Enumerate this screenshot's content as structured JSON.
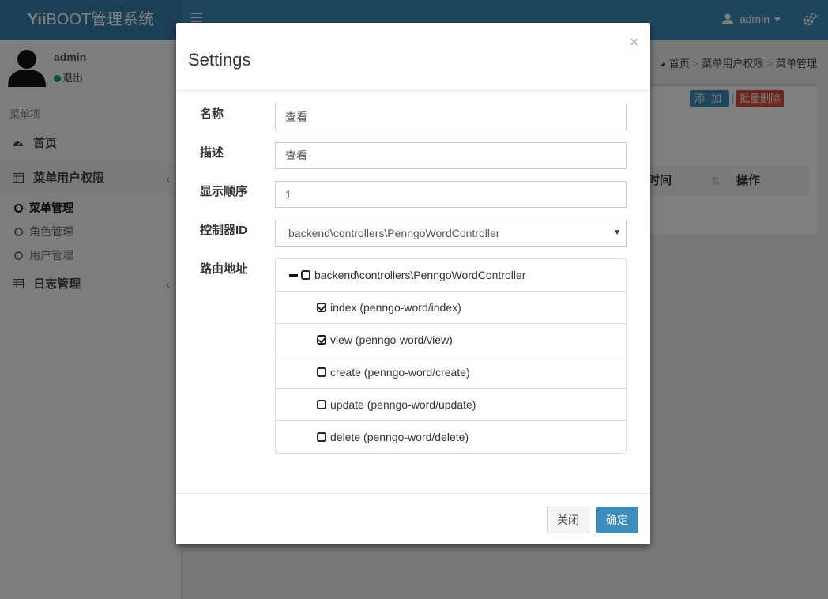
{
  "app": {
    "logo_bold": "Yii",
    "logo_rest": "BOOT管理系统",
    "user_menu": "admin"
  },
  "sidebar": {
    "user_name": "admin",
    "status": "退出",
    "menu_header": "菜单项",
    "items": [
      {
        "label": "首页"
      },
      {
        "label": "菜单用户权限"
      },
      {
        "label": "日志管理"
      }
    ],
    "subitems": [
      {
        "label": "菜单管理"
      },
      {
        "label": "角色管理"
      },
      {
        "label": "用户管理"
      }
    ]
  },
  "breadcrumb": [
    "首页",
    "菜单用户权限",
    "菜单管理"
  ],
  "content": {
    "add_label": "添加",
    "delete_label": "批量删除",
    "col_time": "时间",
    "col_ops": "操作"
  },
  "modal": {
    "title": "Settings",
    "close": "×",
    "labels": {
      "name": "名称",
      "desc": "描述",
      "order": "显示顺序",
      "controller": "控制器ID",
      "route": "路由地址"
    },
    "values": {
      "name": "查看",
      "desc": "查看",
      "order": "1",
      "controller": "backend\\controllers\\PenngoWordController"
    },
    "tree_root": "backend\\controllers\\PenngoWordController",
    "routes": [
      {
        "label": "index  (penngo-word/index)",
        "checked": true
      },
      {
        "label": "view  (penngo-word/view)",
        "checked": true
      },
      {
        "label": "create  (penngo-word/create)",
        "checked": false
      },
      {
        "label": "update  (penngo-word/update)",
        "checked": false
      },
      {
        "label": "delete  (penngo-word/delete)",
        "checked": false
      }
    ],
    "btn_close": "关闭",
    "btn_ok": "确定"
  },
  "colors": {
    "primary": "#3c8dbc",
    "danger": "#dd4b39",
    "online": "#00a65a"
  }
}
